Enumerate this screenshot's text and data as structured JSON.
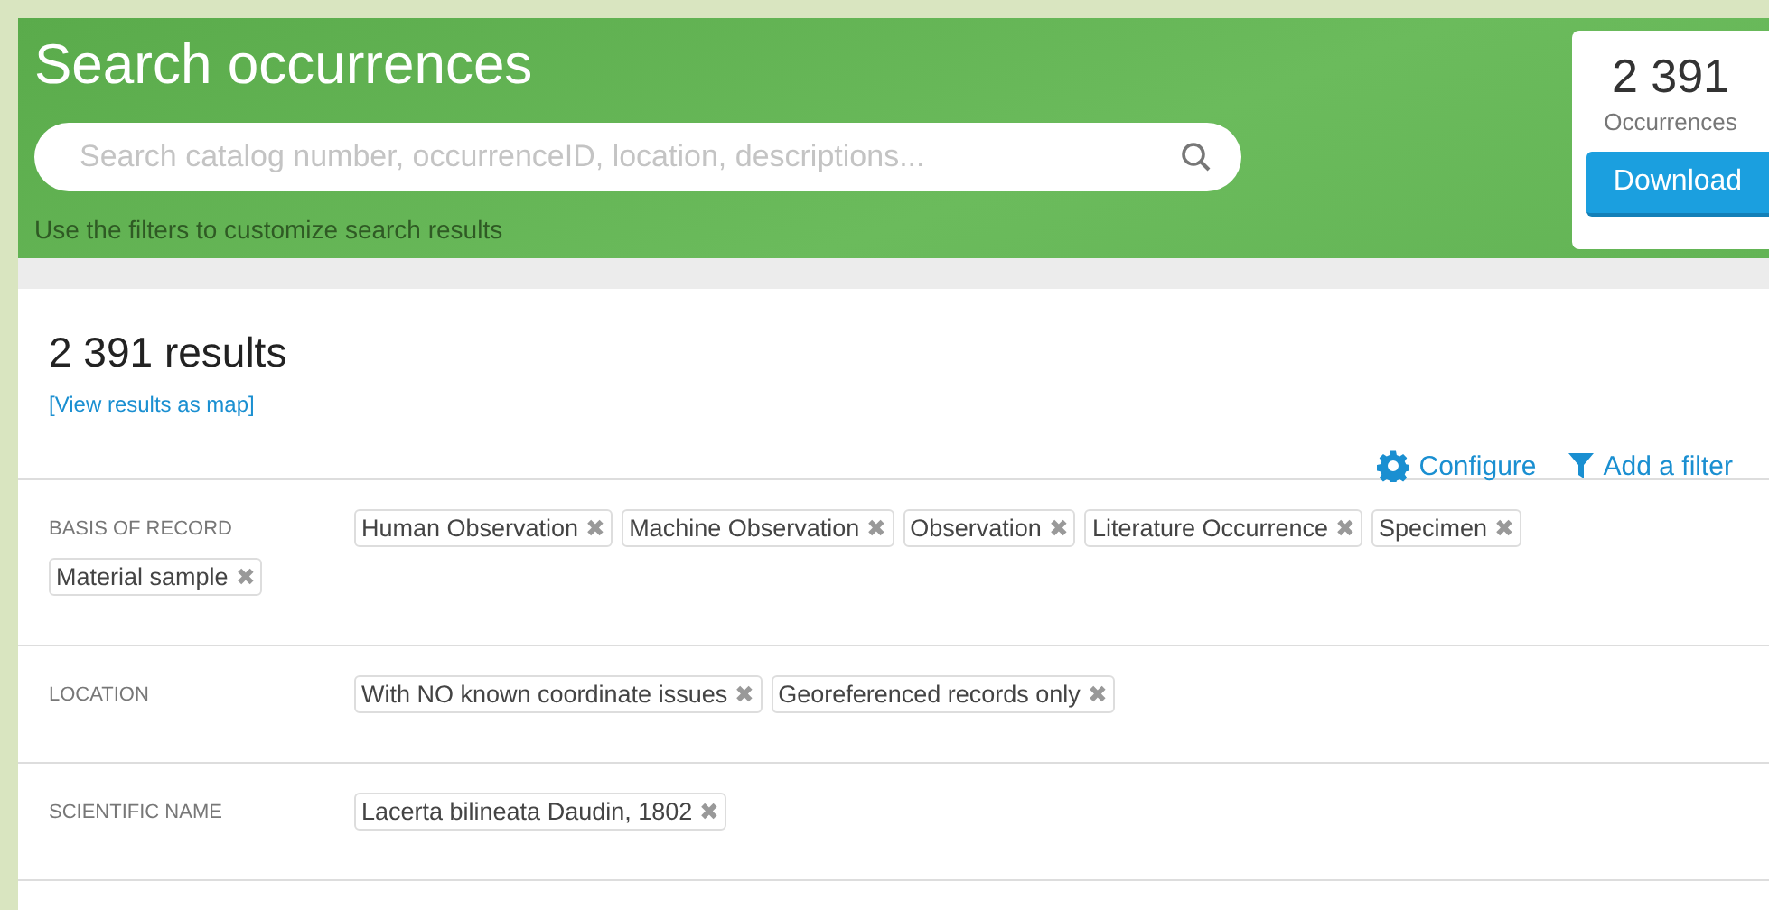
{
  "header": {
    "title": "Search occurrences",
    "search": {
      "placeholder": "Search catalog number, occurrenceID, location, descriptions..."
    },
    "hint": "Use the filters to customize search results"
  },
  "counter": {
    "count": "2 391",
    "label": "Occurrences",
    "button": "Download"
  },
  "results": {
    "title": "2 391 results",
    "map_link": "[View results as map]",
    "actions": [
      {
        "kind": "configure",
        "label": "Configure"
      },
      {
        "kind": "filter",
        "label": "Add a filter"
      }
    ]
  },
  "filters": [
    {
      "label": "BASIS OF RECORD",
      "chips": [
        "Human Observation",
        "Machine Observation",
        "Observation",
        "Literature Occurrence",
        "Specimen",
        "Material sample"
      ]
    },
    {
      "label": "LOCATION",
      "chips": [
        "With NO known coordinate issues",
        "Georeferenced records only"
      ]
    },
    {
      "label": "SCIENTIFIC NAME",
      "chips": [
        "Lacerta bilineata Daudin, 1802"
      ]
    }
  ],
  "chip_remove": "✖"
}
